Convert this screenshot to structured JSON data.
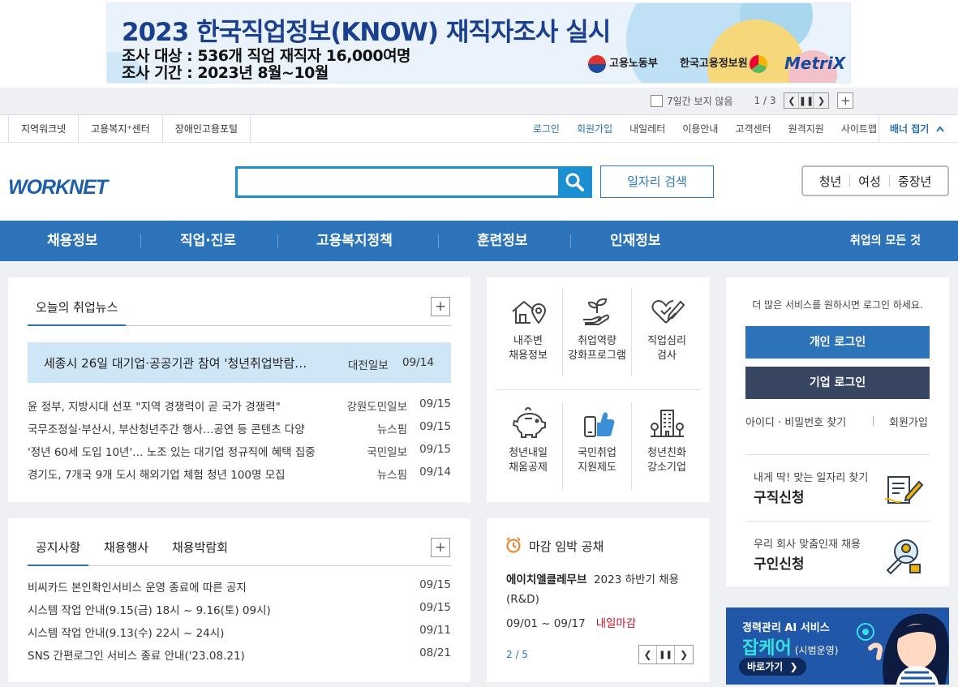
{
  "banner": {
    "title": "2023 한국직업정보(KNOW) 재직자조사 실시",
    "line1": "조사 대상 : 536개 직업 재직자 16,000여명",
    "line2": "조사 기간 : 2023년 8월~10월",
    "logo1": "고용노동부",
    "logo2": "한국고용정보원",
    "logo3": "MetriX",
    "hide_label": "7일간 보지 않음",
    "page": "1 / 3"
  },
  "util": {
    "left": [
      "지역워크넷",
      "고용복지⁺센터",
      "장애인고용포털"
    ],
    "right": [
      "로그인",
      "회원가입",
      "내일레터",
      "이용안내",
      "고객센터",
      "원격지원",
      "사이트맵"
    ],
    "fold": "배너 접기"
  },
  "header": {
    "logo": "WORKNET",
    "search_placeholder": "",
    "job_search": "일자리 검색",
    "age": [
      "청년",
      "여성",
      "중장년"
    ]
  },
  "gnb": {
    "items": [
      "채용정보",
      "직업·진로",
      "고용복지정책",
      "훈련정보",
      "인재정보"
    ],
    "all": "취업의 모든 것"
  },
  "news": {
    "tab": "오늘의 취업뉴스",
    "featured": {
      "title": "세종시 26일 대기업·공공기관 참여 '청년취업박람…",
      "source": "대전일보",
      "date": "09/14"
    },
    "items": [
      {
        "title": "윤 정부, 지방시대 선포 \"지역 경쟁력이 곧 국가 경쟁력\"",
        "source": "강원도민일보",
        "date": "09/15"
      },
      {
        "title": "국무조정실·부산시, 부산청년주간 행사…공연 등 콘텐츠 다양",
        "source": "뉴스핌",
        "date": "09/15"
      },
      {
        "title": "'정년 60세 도입 10년'… 노조 있는 대기업 정규직에 혜택 집중",
        "source": "국민일보",
        "date": "09/15"
      },
      {
        "title": "경기도, 7개국 9개 도시 해외기업 체험 청년 100명 모집",
        "source": "뉴스핌",
        "date": "09/14"
      }
    ]
  },
  "services": [
    {
      "l1": "내주변",
      "l2": "채용정보"
    },
    {
      "l1": "취업역량",
      "l2": "강화프로그램"
    },
    {
      "l1": "직업심리",
      "l2": "검사"
    },
    {
      "l1": "청년내일",
      "l2": "채움공제"
    },
    {
      "l1": "국민취업",
      "l2": "지원제도"
    },
    {
      "l1": "청년친화",
      "l2": "강소기업"
    }
  ],
  "login": {
    "notice": "더 많은 서비스를 원하시면 로그인 하세요.",
    "personal": "개인 로그인",
    "company": "기업 로그인",
    "find": "아이디 · 비밀번호 찾기",
    "join": "회원가입",
    "seek_sub": "내게 딱! 맞는 일자리 찾기",
    "seek_title": "구직신청",
    "hire_sub": "우리 회사 맞춤인재 채용",
    "hire_title": "구인신청"
  },
  "notice": {
    "tabs": [
      "공지사항",
      "채용행사",
      "채용박람회"
    ],
    "items": [
      {
        "title": "비씨카드 본인확인서비스 운영 종료에 따른 공지",
        "date": "09/15"
      },
      {
        "title": "시스템 작업 안내(9.15(금) 18시 ~ 9.16(토) 09시)",
        "date": "09/15"
      },
      {
        "title": "시스템 작업 안내(9.13(수) 22시 ~ 24시)",
        "date": "09/11"
      },
      {
        "title": "SNS 간편로그인 서비스 종료 안내('23.08.21)",
        "date": "08/21"
      }
    ]
  },
  "deadline": {
    "title": "마감 임박 공채",
    "company": "에이치엘클레무브",
    "job1": "2023 하반기 채용",
    "job2": "(R&D)",
    "period": "09/01 ~ 09/17",
    "status": "내일마감",
    "page": "2 / 5"
  },
  "ai": {
    "line1": "경력관리 AI 서비스",
    "brand": "잡케어",
    "note": "(시범운영)",
    "cta": "바로가기"
  }
}
